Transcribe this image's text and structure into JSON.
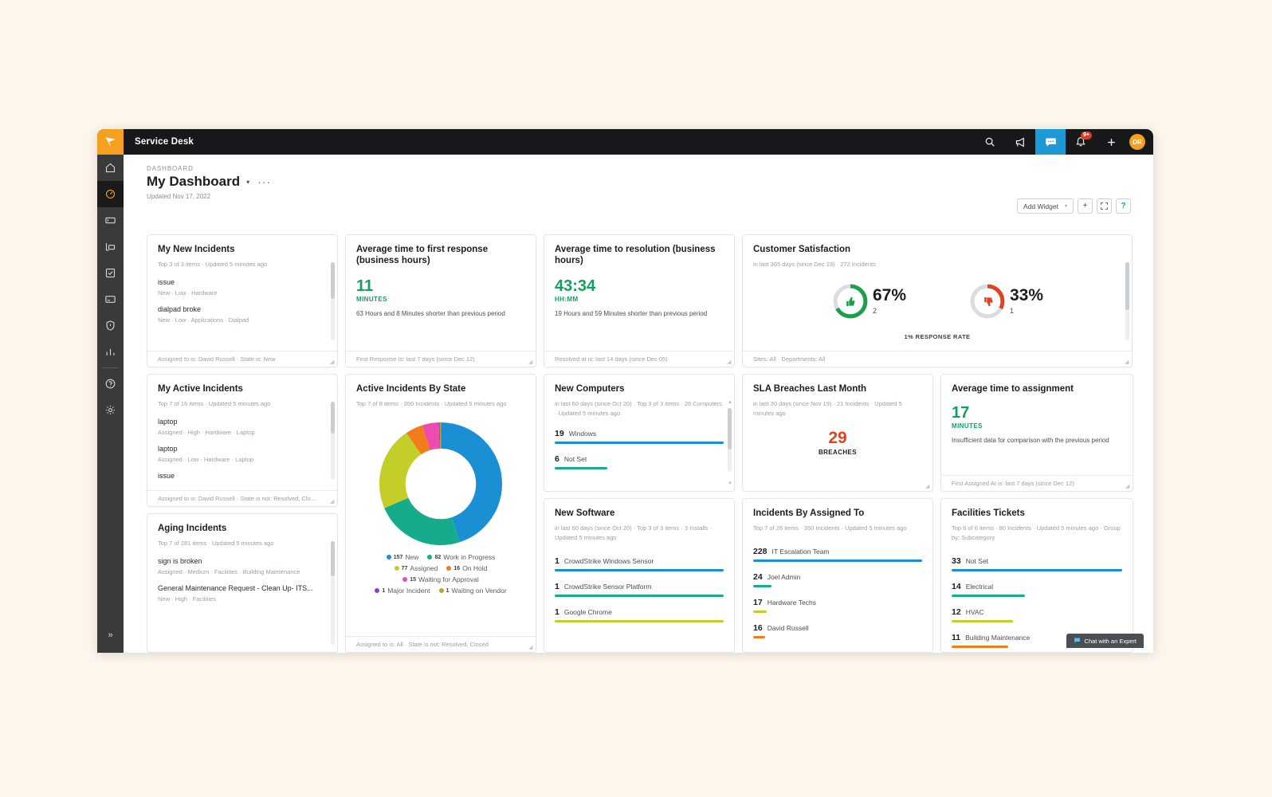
{
  "app": {
    "title": "Service Desk",
    "brand_color": "#f5a01e",
    "accent_color": "#1b9ad6"
  },
  "topbar": {
    "search_label": "search-icon",
    "announce_label": "megaphone-icon",
    "chat_label": "chat-icon",
    "bell_label": "bell-icon",
    "bell_badge": "9+",
    "add_label": "plus-icon",
    "avatar_initials": "DR"
  },
  "sidebar": {
    "items": [
      {
        "name": "home",
        "icon": "home-icon",
        "active": false
      },
      {
        "name": "dashboard",
        "icon": "gauge-icon",
        "active": true
      },
      {
        "name": "tickets",
        "icon": "ticket-icon",
        "active": false
      },
      {
        "name": "assets",
        "icon": "monitor-icon",
        "active": false
      },
      {
        "name": "tasks",
        "icon": "checkbox-icon",
        "active": false
      },
      {
        "name": "purchasing",
        "icon": "card-icon",
        "active": false
      },
      {
        "name": "security",
        "icon": "shield-icon",
        "active": false
      },
      {
        "name": "reports",
        "icon": "bar-chart-icon",
        "active": false
      }
    ],
    "bottom_items": [
      {
        "name": "help",
        "icon": "question-circle-icon"
      },
      {
        "name": "settings",
        "icon": "gear-icon"
      }
    ],
    "expand_label": "»"
  },
  "header": {
    "breadcrumb": "DASHBOARD",
    "title": "My Dashboard",
    "caret": "▾",
    "more": "···",
    "updated": "Updated Nov 17, 2022",
    "add_widget_label": "Add Widget",
    "add_widget_caret": "▾",
    "plus_label": "+",
    "fullscreen_label": "⛶",
    "help_label": "?"
  },
  "widgets": {
    "my_new_incidents": {
      "title": "My New Incidents",
      "subtitle": "Top 3 of 3 items · Updated 5 minutes ago",
      "items": [
        {
          "title": "issue",
          "meta": "New · Low · Hardware"
        },
        {
          "title": "dialpad broke",
          "meta": "New · Low · Applications · Dialpad"
        }
      ],
      "footer": "Assigned to is: David Russell · State is: New"
    },
    "my_active_incidents": {
      "title": "My Active Incidents",
      "subtitle": "Top 7 of 16 items · Updated 5 minutes ago",
      "items": [
        {
          "title": "laptop",
          "meta": "Assigned · High · Hardware · Laptop"
        },
        {
          "title": "laptop",
          "meta": "Assigned · Low · Hardware · Laptop"
        },
        {
          "title": "issue",
          "meta": ""
        }
      ],
      "footer": "Assigned to is: David Russell · State is not: Resolved, Clo..."
    },
    "aging_incidents": {
      "title": "Aging Incidents",
      "subtitle": "Top 7 of 281 items · Updated 5 minutes ago",
      "items": [
        {
          "title": "sign is broken",
          "meta": "Assigned · Medium · Facilities · Building Maintenance"
        },
        {
          "title": "General Maintenance Request - Clean Up- ITS...",
          "meta": "New · High · Facilities"
        }
      ]
    },
    "avg_first_response": {
      "title": "Average time to first response (business hours)",
      "value": "11",
      "unit": "MINUTES",
      "note": "63 Hours and 8 Minutes shorter than previous period",
      "footer": "First Response Is: last 7 days (since Dec 12)"
    },
    "avg_resolution": {
      "title": "Average time to resolution (business hours)",
      "value": "43:34",
      "unit": "HH:MM",
      "note": "19 Hours and 59 Minutes shorter than previous period",
      "footer": "Resolved at is: last 14 days (since Dec 05)"
    },
    "customer_satisfaction": {
      "title": "Customer Satisfaction",
      "subtitle": "in last 365 days (since Dec 19) · 272 Incidents",
      "positive": {
        "pct": "67%",
        "count": "2",
        "color": "#19a04b",
        "icon": "thumbs-up-icon"
      },
      "negative": {
        "pct": "33%",
        "count": "1",
        "color": "#e2431f",
        "icon": "thumbs-down-icon"
      },
      "response_rate": "1% RESPONSE RATE",
      "footer": "Sites: All · Departments: All"
    },
    "active_by_state": {
      "title": "Active Incidents By State",
      "subtitle": "Top 7 of 8 items · 350 Incidents · Updated 5 minutes ago",
      "footer": "Assigned to is: All · State is not: Resolved, Closed"
    },
    "new_computers": {
      "title": "New Computers",
      "subtitle": "in last 60 days (since Oct 20) · Top 3 of 3 items · 26 Computers · Updated 5 minutes ago",
      "rows": [
        {
          "value": "19",
          "name": "Windows",
          "pct": 100,
          "color": "#1b8fd4"
        },
        {
          "value": "6",
          "name": "Not Set",
          "pct": 31,
          "color": "#1aab8a"
        }
      ]
    },
    "sla_breaches": {
      "title": "SLA Breaches Last Month",
      "subtitle": "in last 30 days (since Nov 19) · 21 Incidents · Updated 5 minutes ago",
      "value": "29",
      "unit": "BREACHES"
    },
    "avg_assignment": {
      "title": "Average time to assignment",
      "value": "17",
      "unit": "MINUTES",
      "note": "Insufficient data for comparison with the previous period",
      "footer": "First Assigned At is: last 7 days (since Dec 12)"
    },
    "new_software": {
      "title": "New Software",
      "subtitle": "in last 60 days (since Oct 20) · Top 3 of 3 items · 3 Installs · Updated 5 minutes ago",
      "rows": [
        {
          "value": "1",
          "name": "CrowdStrike Windows Sensor",
          "pct": 100,
          "color": "#1b8fd4"
        },
        {
          "value": "1",
          "name": "CrowdStrike Sensor Platform",
          "pct": 100,
          "color": "#1aab8a"
        },
        {
          "value": "1",
          "name": "Google Chrome",
          "pct": 100,
          "color": "#c3ce2a"
        }
      ]
    },
    "incidents_by_assigned": {
      "title": "Incidents By Assigned To",
      "subtitle": "Top 7 of 26 items · 350 Incidents · Updated 5 minutes ago",
      "rows": [
        {
          "value": "228",
          "name": "IT Escalation Team",
          "pct": 100,
          "color": "#1b8fd4"
        },
        {
          "value": "24",
          "name": "Joel Admin",
          "pct": 11,
          "color": "#1aab8a"
        },
        {
          "value": "17",
          "name": "Hardware Techs",
          "pct": 8,
          "color": "#c3ce2a"
        },
        {
          "value": "16",
          "name": "David Russell",
          "pct": 7,
          "color": "#f07d1a"
        }
      ]
    },
    "facilities_tickets": {
      "title": "Facilities Tickets",
      "subtitle": "Top 6 of 6 items · 80 Incidents · Updated 5 minutes ago · Group by: Subcategory",
      "rows": [
        {
          "value": "33",
          "name": "Not Set",
          "pct": 100,
          "color": "#1b8fd4"
        },
        {
          "value": "14",
          "name": "Electrical",
          "pct": 43,
          "color": "#1aab8a"
        },
        {
          "value": "12",
          "name": "HVAC",
          "pct": 36,
          "color": "#c3ce2a"
        },
        {
          "value": "11",
          "name": "Building Maintenance",
          "pct": 33,
          "color": "#f07d1a"
        }
      ]
    }
  },
  "chat_fab": {
    "label": "Chat with an Expert",
    "icon": "chat-bubble-icon"
  },
  "chart_data": {
    "type": "pie",
    "title": "Active Incidents By State",
    "subtitle": "Top 7 of 8 items · 350 Incidents · Updated 5 minutes ago",
    "total": 350,
    "legend_position": "bottom",
    "categories": [
      "New",
      "Work in Progress",
      "Assigned",
      "On Hold",
      "Waiting for Approval",
      "Major Incident",
      "Waiting on Vendor"
    ],
    "values": [
      157,
      82,
      77,
      16,
      15,
      1,
      1
    ],
    "colors": [
      "#1b8fd4",
      "#16ab8a",
      "#c3ce2a",
      "#f07d1a",
      "#ec4bb0",
      "#8b3fd1",
      "#b8a42a"
    ]
  }
}
